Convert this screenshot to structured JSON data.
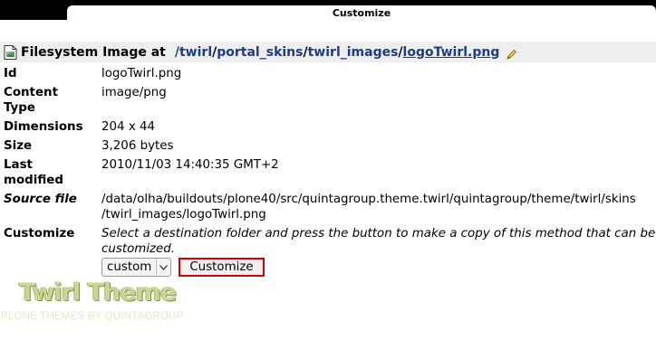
{
  "window": {
    "tab_title": "Customize"
  },
  "header": {
    "label": "Filesystem Image at",
    "path": [
      {
        "text": "/twirl"
      },
      {
        "text": "/"
      },
      {
        "text": "portal_skins"
      },
      {
        "text": "/"
      },
      {
        "text": "twirl_images"
      },
      {
        "text": "/"
      },
      {
        "text": "logoTwirl.png"
      }
    ]
  },
  "properties": {
    "id": {
      "key": "Id",
      "value": "logoTwirl.png"
    },
    "content_type": {
      "key_line1": "Content",
      "key_line2": "Type",
      "value": "image/png"
    },
    "dimensions": {
      "key": "Dimensions",
      "value": "204 x 44"
    },
    "size": {
      "key": "Size",
      "value": "3,206 bytes"
    },
    "last_modified": {
      "key_line1": "Last",
      "key_line2": "modified",
      "value": "2010/11/03 14:40:35 GMT+2"
    },
    "source_file": {
      "key": "Source file",
      "value_line1": "/data/olha/buildouts/plone40/src/quintagroup.theme.twirl/quintagroup/theme/twirl/skins",
      "value_line2": "/twirl_images/logoTwirl.png"
    },
    "customize": {
      "key": "Customize",
      "instruction": "Select a destination folder and press the button to make a copy of this method that can be customized.",
      "folder_select": "custom",
      "button_label": "Customize"
    }
  },
  "logo": {
    "title": "Twirl Theme",
    "subtitle": "PLONE THEMES BY QUINTAGROUP"
  }
}
